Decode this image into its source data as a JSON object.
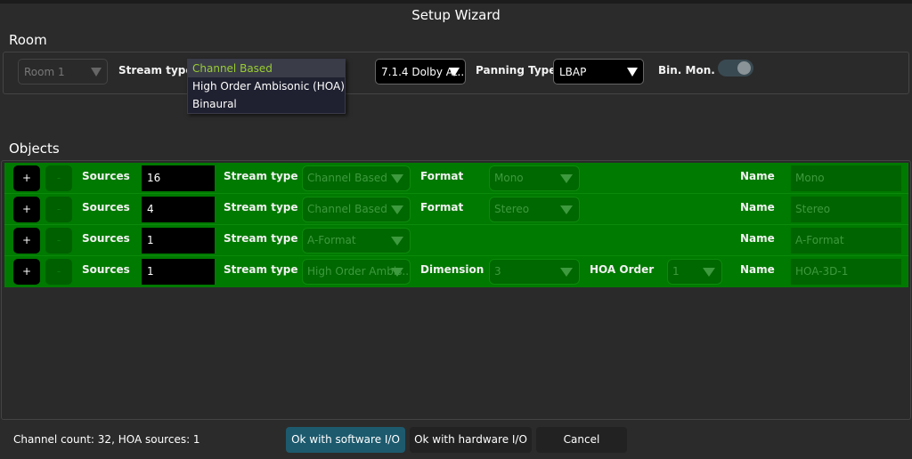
{
  "title": "Setup Wizard",
  "room": {
    "heading": "Room",
    "room_select": "Room 1",
    "stream_type_label": "Stream type",
    "format_select": "7.1.4 Dolby At..",
    "panning_label": "Panning Type",
    "panning_select": "LBAP",
    "binmon_label": "Bin. Mon.",
    "binmon_on": true
  },
  "dropdown": {
    "options": [
      "Channel Based",
      "High Order Ambisonic (HOA)",
      "Binaural"
    ],
    "selected": "Channel Based"
  },
  "objects": {
    "heading": "Objects",
    "labels": {
      "plus": "+",
      "minus": "-",
      "sources": "Sources",
      "stream_type": "Stream type",
      "format": "Format",
      "dimension": "Dimension",
      "hoa_order": "HOA Order",
      "name": "Name"
    },
    "rows": [
      {
        "sources": "16",
        "stream_type": "Channel Based",
        "format": "Mono",
        "name": "Mono"
      },
      {
        "sources": "4",
        "stream_type": "Channel Based",
        "format": "Stereo",
        "name": "Stereo"
      },
      {
        "sources": "1",
        "stream_type": "A-Format",
        "name": "A-Format"
      },
      {
        "sources": "1",
        "stream_type": "High Order Ambis..",
        "dimension": "3",
        "hoa_order": "1",
        "name": "HOA-3D-1"
      }
    ]
  },
  "footer": {
    "status": "Channel count: 32, HOA sources: 1",
    "ok_software": "Ok with software I/O",
    "ok_hardware": "Ok with hardware I/O",
    "cancel": "Cancel"
  }
}
